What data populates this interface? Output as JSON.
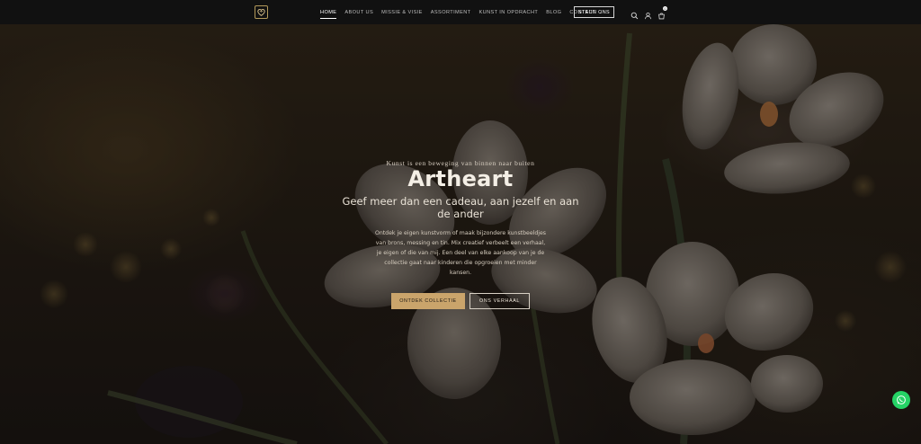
{
  "header": {
    "logo_icon": "heart-logo-icon",
    "nav": [
      {
        "label": "HOME",
        "active": true
      },
      {
        "label": "ABOUT US",
        "active": false
      },
      {
        "label": "MISSIE & VISIE",
        "active": false
      },
      {
        "label": "ASSORTIMENT",
        "active": false
      },
      {
        "label": "KUNST IN OPDRACHT",
        "active": false
      },
      {
        "label": "BLOG",
        "active": false
      },
      {
        "label": "CONTACT",
        "active": false
      }
    ],
    "cta_label": "STEUN ONS",
    "icons": [
      "search-icon",
      "user-icon",
      "cart-icon"
    ],
    "cart_count": "0"
  },
  "hero": {
    "tagline": "Kunst is een beweging van binnen naar buiten",
    "title": "Artheart",
    "subtitle": "Geef meer dan een cadeau, aan jezelf en aan de ander",
    "body": "Ontdek je eigen kunstvorm of maak bijzondere kunstbeeldjes van brons, messing en tin. Mix creatief verbeelt een verhaal, je eigen of die van mij. Een deel van elke aankoop van je de collectie gaat naar kinderen die opgroeien met minder kansen.",
    "primary_button": "ONTDEK COLLECTIE",
    "secondary_button": "ONS VERHAAL"
  },
  "floating": {
    "whatsapp_icon": "whatsapp-icon"
  },
  "colors": {
    "accent": "#caa46b",
    "header_bg": "#111111",
    "whatsapp": "#25d366"
  }
}
